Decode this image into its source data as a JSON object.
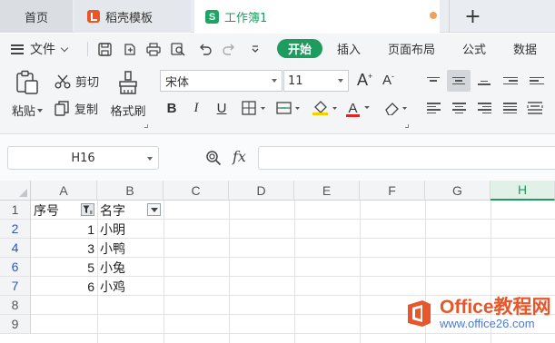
{
  "tabs": {
    "home": "首页",
    "templates": "稻壳模板",
    "workbook": "工作簿1",
    "add": "+"
  },
  "menu": {
    "file": "文件",
    "start": "开始",
    "items": [
      "插入",
      "页面布局",
      "公式",
      "数据"
    ]
  },
  "ribbon": {
    "paste": "粘贴",
    "cut": "剪切",
    "copy": "复制",
    "format_painter": "格式刷",
    "font_name": "宋体",
    "font_size": "11",
    "bold": "B",
    "italic": "I",
    "underline": "U",
    "font_color_letter": "A",
    "grow_font": "A",
    "shrink_font": "A"
  },
  "formula_bar": {
    "name_box": "H16",
    "fx": "fx",
    "formula": ""
  },
  "sheet": {
    "columns": [
      "A",
      "B",
      "C",
      "D",
      "E",
      "F",
      "G",
      "H"
    ],
    "selected_column": "H",
    "rows": [
      {
        "num": "1",
        "a": "序号",
        "b": "名字",
        "filtered": false
      },
      {
        "num": "2",
        "a": "1",
        "b": "小明",
        "filtered": true
      },
      {
        "num": "4",
        "a": "3",
        "b": "小鸭",
        "filtered": true
      },
      {
        "num": "6",
        "a": "5",
        "b": "小兔",
        "filtered": true
      },
      {
        "num": "7",
        "a": "6",
        "b": "小鸡",
        "filtered": true
      },
      {
        "num": "8",
        "a": "",
        "b": "",
        "filtered": false
      },
      {
        "num": "9",
        "a": "",
        "b": "",
        "filtered": false
      }
    ]
  },
  "watermark": {
    "brand": "Office教程网",
    "url": "www.office26.com"
  },
  "colors": {
    "accent": "#1e9b5e",
    "filtered_row": "#2b56c9",
    "watermark_orange": "#e8562a"
  }
}
